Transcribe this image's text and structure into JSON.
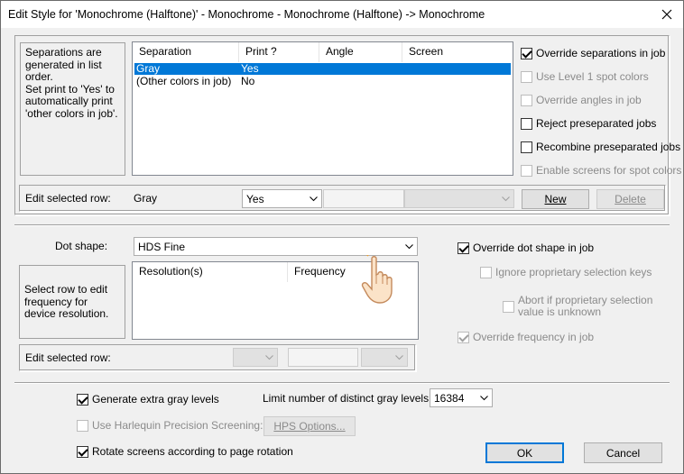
{
  "window": {
    "title": "Edit Style for 'Monochrome (Halftone)' - Monochrome - Monochrome (Halftone) -> Monochrome"
  },
  "separations": {
    "info_lines": [
      "Separations are",
      "generated in list",
      "order.",
      "Set print to 'Yes' to",
      "automatically print",
      "'other colors in job'."
    ],
    "columns": [
      "Separation",
      "Print ?",
      "Angle",
      "Screen"
    ],
    "rows": [
      {
        "separation": "Gray",
        "print": "Yes"
      },
      {
        "separation": "(Other colors in job)",
        "print": "No"
      }
    ],
    "edit_label": "Edit selected row:",
    "edit_value": "Gray",
    "print_select": "Yes",
    "new_label": "New",
    "delete_label": "Delete"
  },
  "sep_options": {
    "override_separations": "Override separations in job",
    "use_level1": "Use Level 1 spot colors",
    "override_angles": "Override angles in job",
    "reject_preseparated": "Reject preseparated jobs",
    "recombine_preseparated": "Recombine preseparated jobs",
    "enable_screens": "Enable screens for spot colors"
  },
  "dot": {
    "label": "Dot shape:",
    "value": "HDS Fine",
    "info_lines": [
      "Select row to edit",
      "frequency for",
      "device resolution."
    ],
    "columns": [
      "Resolution(s)",
      "Frequency"
    ],
    "edit_label": "Edit selected row:",
    "override_dot_shape": "Override dot shape in job",
    "ignore_proprietary": "Ignore proprietary selection keys",
    "abort_line1": "Abort if proprietary selection",
    "abort_line2": "value is unknown",
    "override_frequency": "Override frequency in job"
  },
  "bottom": {
    "generate_gray": "Generate extra gray levels",
    "limit_label": "Limit number of distinct gray levels to:",
    "limit_value": "16384",
    "harlequin": "Use Harlequin Precision Screening:",
    "hps_options": "HPS Options...",
    "rotate_screens": "Rotate screens according to page rotation",
    "ok": "OK",
    "cancel": "Cancel"
  }
}
